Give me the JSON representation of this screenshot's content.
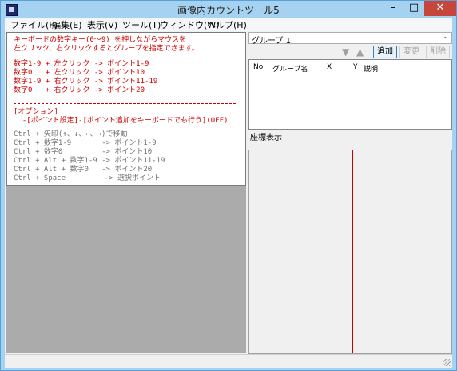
{
  "window": {
    "title": "画像内カウントツール5"
  },
  "menu": [
    "ファイル(F)",
    "編集(E)",
    "表示(V)",
    "ツール(T)",
    "ウィンドウ(W)",
    "ヘルプ(H)"
  ],
  "help": {
    "intro": [
      "キーボードの数字キー(0～9) を押しながらマウスを",
      "左クリック、右クリックするとグループを指定できます。"
    ],
    "mappings": [
      "数字1-9 + 左クリック -> ポイント1-9",
      "数字0   + 左クリック -> ポイント10",
      "数字1-9 + 右クリック -> ポイント11-19",
      "数字0   + 右クリック -> ポイント20"
    ],
    "option_header": "[オプション]",
    "option_line": "  -[ポイント設定]-[ポイント追加をキーボードでも行う](OFF)",
    "keyboard": [
      "Ctrl + 矢印(↑、↓、←、→)で移動",
      "Ctrl + 数字1-9       -> ポイント1-9",
      "Ctrl + 数字0         -> ポイント10",
      "Ctrl + Alt + 数字1-9 -> ポイント11-19",
      "Ctrl + Alt + 数字0   -> ポイント20",
      "Ctrl + Space         -> 選択ポイント"
    ]
  },
  "right": {
    "group_select": "グループ 1",
    "buttons": {
      "add": "追加",
      "edit": "変更",
      "delete": "削除"
    },
    "columns": [
      "No.",
      "グループ名",
      "X",
      "Y",
      "説明"
    ],
    "coord_label": "座標表示"
  },
  "colors": {
    "accent_red": "#cc0000",
    "close_button": "#c7463c",
    "titlebar": "#a4d2f0"
  }
}
